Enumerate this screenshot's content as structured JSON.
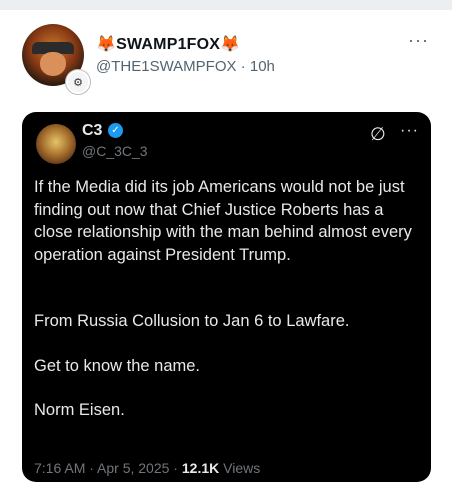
{
  "author": {
    "display_name": "🦊SWAMP1FOX🦊",
    "handle": "@THE1SWAMPFOX",
    "time": "10h",
    "more_label": "···"
  },
  "quoted": {
    "display_name": "C3",
    "verified_mark": "✓",
    "handle": "@C_3C_3",
    "grok_icon": "∅",
    "more_label": "···",
    "paragraphs": [
      "If the Media did its job Americans would not be just finding out now that Chief Justice Roberts has a close relationship with the man behind almost every operation against President Trump.",
      "From Russia Collusion to Jan 6 to Lawfare.",
      "Get to know the name.",
      "Norm Eisen."
    ],
    "timestamp": "7:16 AM · Apr 5, 2025 · ",
    "views_count": "12.1K",
    "views_label": " Views"
  },
  "colors": {
    "background": "#ffffff",
    "card": "#000000",
    "secondary_text": "#536471",
    "verified": "#1d9bf0"
  }
}
